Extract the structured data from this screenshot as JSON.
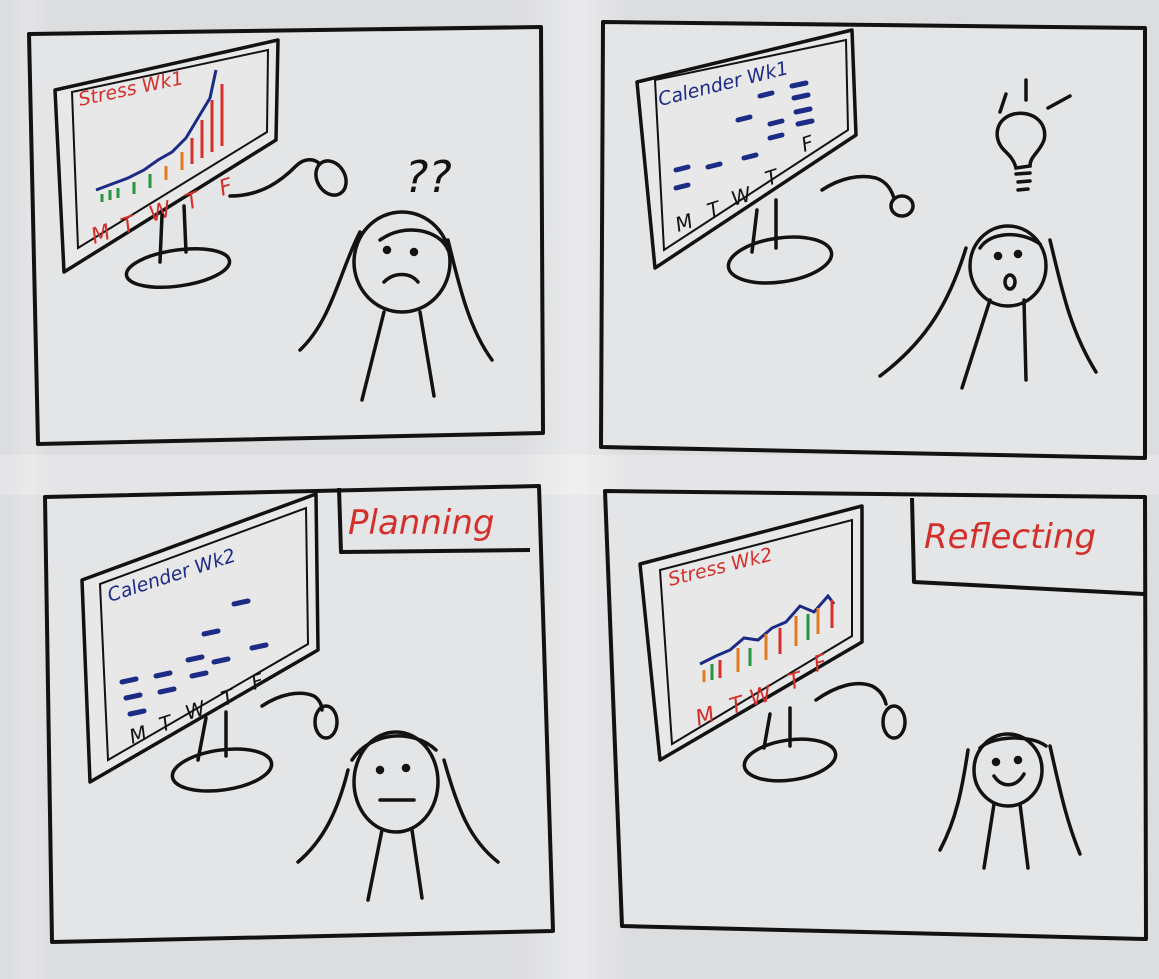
{
  "colors": {
    "ink": "#121212",
    "red": "#d4302b",
    "blue": "#1c2b86",
    "green": "#25963f",
    "orange": "#e27a1e",
    "board": "#e3e4e5"
  },
  "panels": [
    {
      "screen_title": "Stress Wk1",
      "screen_kind": "stress",
      "day_labels": [
        "M",
        "T",
        "W",
        "T",
        "F"
      ],
      "thought": "??",
      "face": "frown"
    },
    {
      "screen_title": "Calender Wk1",
      "screen_kind": "calendar",
      "day_labels": [
        "M",
        "T",
        "W",
        "T",
        "F"
      ],
      "thought_icon": "lightbulb-icon",
      "face": "surprised"
    },
    {
      "screen_title": "Calender Wk2",
      "screen_kind": "calendar",
      "day_labels": [
        "M",
        "T",
        "W",
        "T",
        "F"
      ],
      "caption": "Planning",
      "face": "neutral"
    },
    {
      "screen_title": "Stress Wk2",
      "screen_kind": "stress",
      "day_labels": [
        "M",
        "T",
        "W",
        "T",
        "F"
      ],
      "caption": "Reflecting",
      "face": "smile"
    }
  ]
}
